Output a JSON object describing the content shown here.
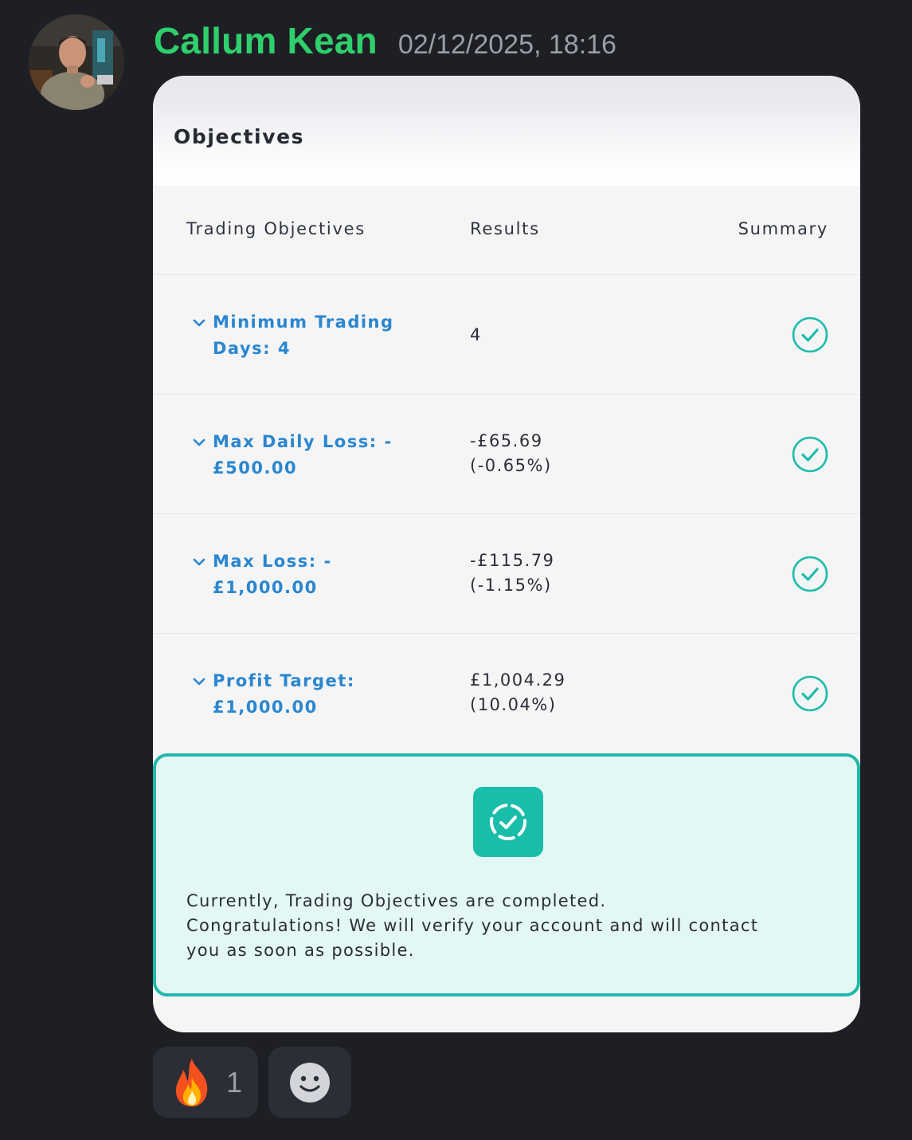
{
  "message": {
    "author": "Callum Kean",
    "timestamp": "02/12/2025, 18:16",
    "avatar_icon": "user-avatar"
  },
  "card": {
    "title": "Objectives",
    "columns": [
      "Trading Objectives",
      "Results",
      "Summary"
    ],
    "rows": [
      {
        "objective_lines": [
          "Minimum Trading",
          "Days:  4"
        ],
        "result_lines": [
          "4"
        ],
        "status": "passed"
      },
      {
        "objective_lines": [
          "Max Daily Loss:  -",
          "£500.00"
        ],
        "result_lines": [
          "-£65.69",
          "(-0.65%)"
        ],
        "status": "passed"
      },
      {
        "objective_lines": [
          "Max Loss:  -",
          "£1,000.00"
        ],
        "result_lines": [
          "-£115.79",
          "(-1.15%)"
        ],
        "status": "passed"
      },
      {
        "objective_lines": [
          "Profit Target:",
          "£1,000.00"
        ],
        "result_lines": [
          "£1,004.29",
          "(10.04%)"
        ],
        "status": "passed"
      }
    ],
    "success": {
      "lines": [
        "Currently, Trading Objectives are completed.",
        "Congratulations! We will verify your account and will contact",
        "you as soon as possible."
      ],
      "icon": "verified-badge-icon"
    }
  },
  "reactions": [
    {
      "emoji": "fire",
      "count": "1"
    },
    {
      "emoji": "add-reaction",
      "count": ""
    }
  ],
  "colors": {
    "background": "#1e1f24",
    "author": "#2fcf6c",
    "timestamp": "#9c9ea6",
    "objective_text": "#2a86cf",
    "check": "#1fbcac",
    "success_bg": "#e3f7f5",
    "success_border": "#20b9aa"
  }
}
